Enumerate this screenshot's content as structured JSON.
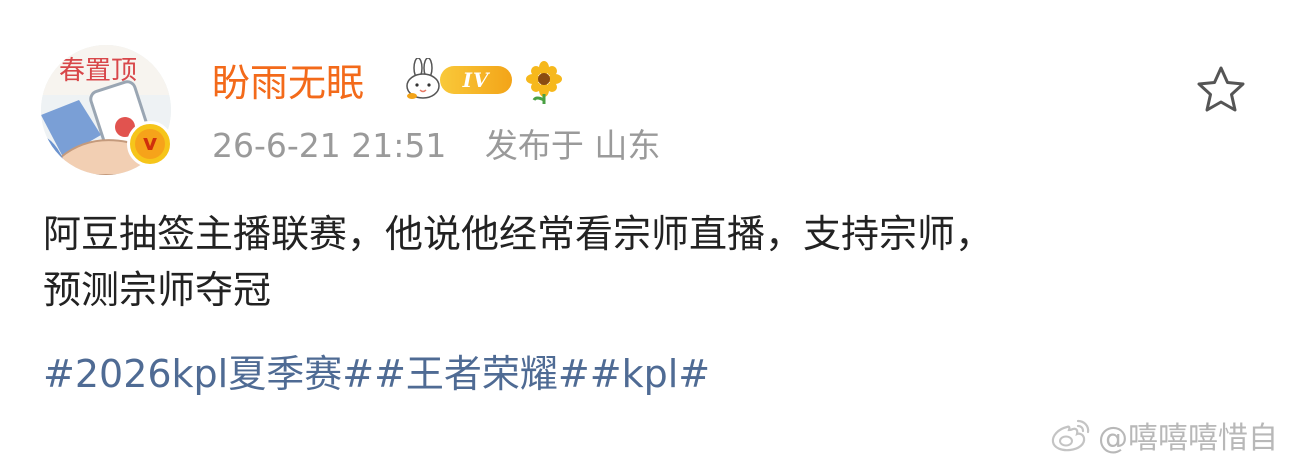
{
  "post": {
    "author": {
      "username": "盼雨无眠",
      "level_badge": "IV",
      "verified": true
    },
    "meta": {
      "timestamp": "26-6-21 21:51",
      "location_prefix": "发布于",
      "location": "山东"
    },
    "avatar_text": "春置顶",
    "content_lines": [
      "阿豆抽签主播联赛，他说他经常看宗师直播，支持宗师，",
      "预测宗师夺冠"
    ],
    "hashtags": [
      "#2026kpl夏季赛#",
      "#王者荣耀#",
      "#kpl#"
    ],
    "favorite_icon": "star-icon"
  },
  "watermark": {
    "text": "@嘻嘻嘻惜自",
    "icon": "weibo-logo-icon"
  },
  "colors": {
    "username": "#f36a1a",
    "meta": "#9a9a9a",
    "content": "#222222",
    "hashtag": "#4f6b94",
    "badge_gold": "#f6c51a"
  }
}
